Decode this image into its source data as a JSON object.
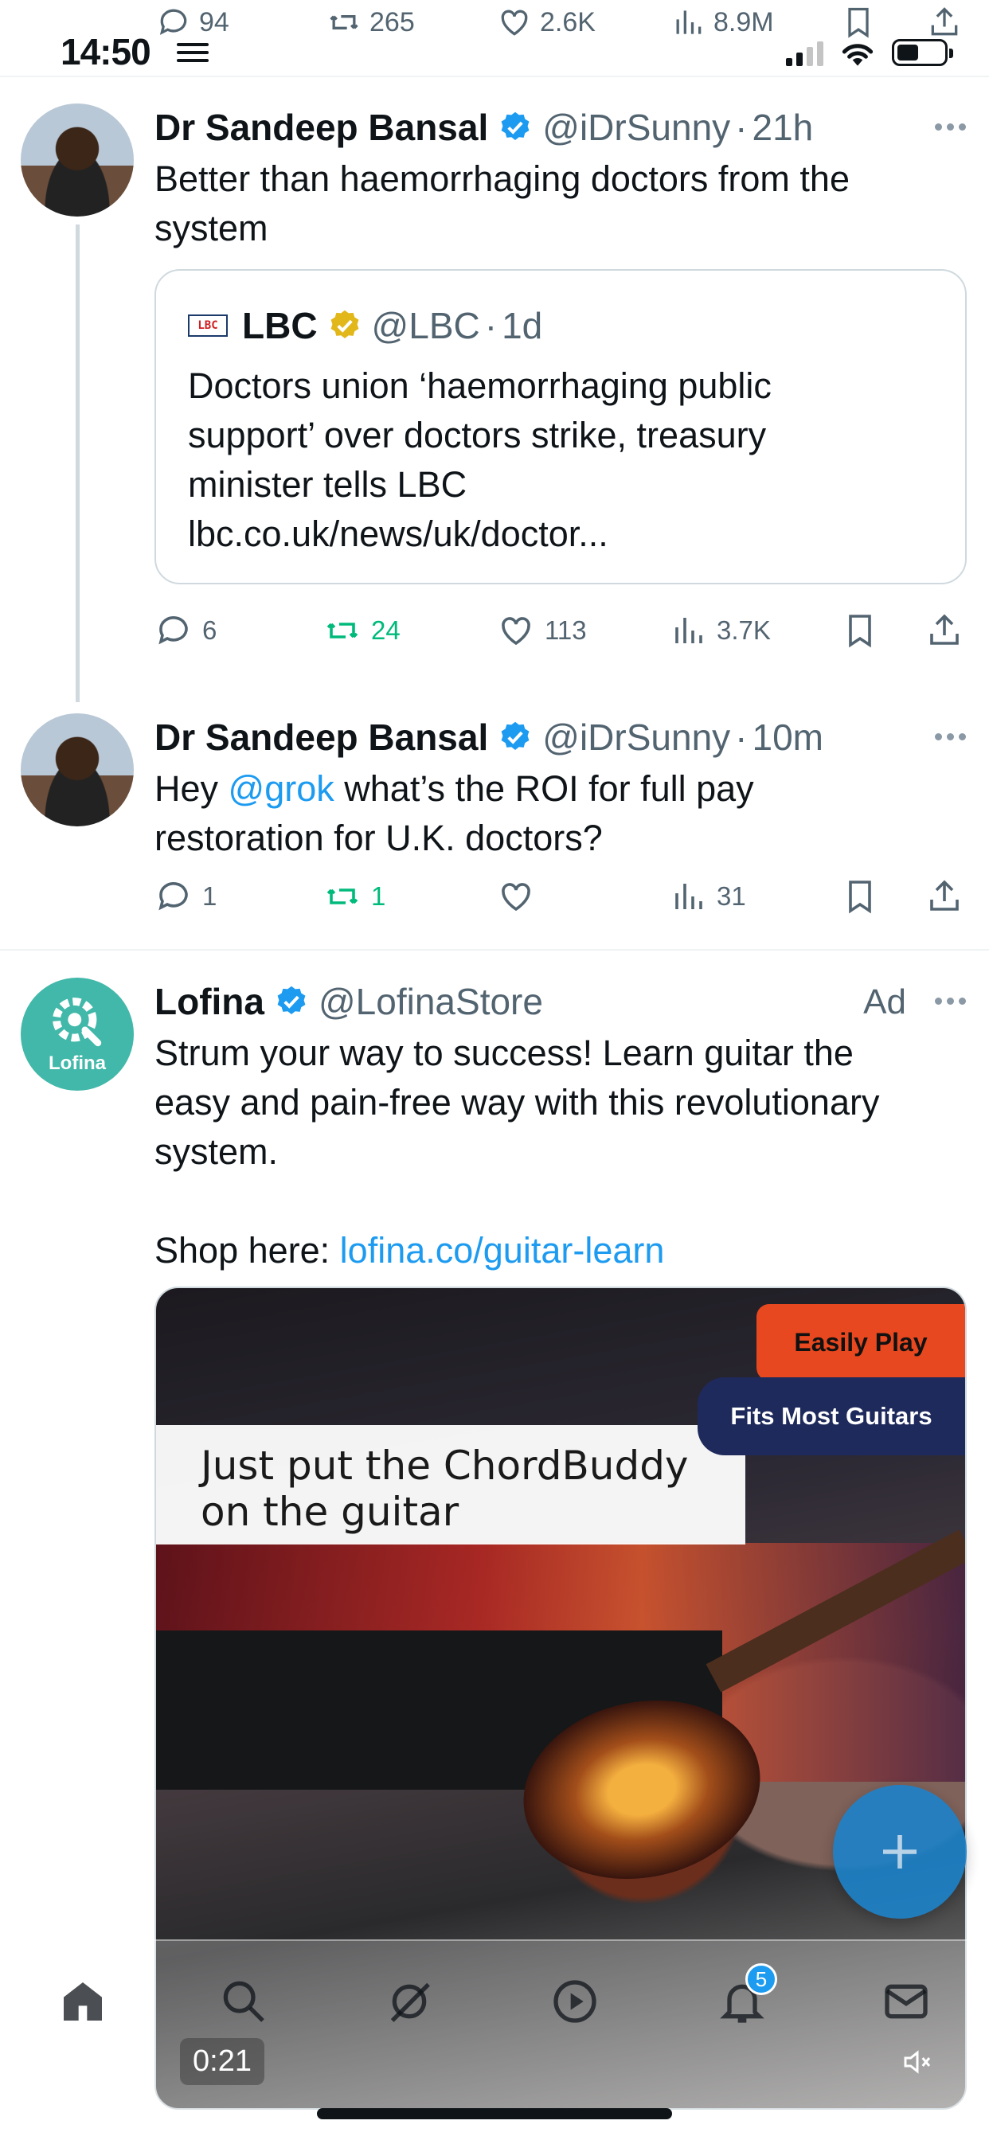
{
  "status_bar": {
    "time": "14:50"
  },
  "prev_actions": {
    "replies": "94",
    "reposts": "265",
    "likes": "2.6K",
    "views": "8.9M"
  },
  "tweets": [
    {
      "name": "Dr Sandeep Bansal",
      "handle": "@iDrSunny",
      "time": "21h",
      "text": "Better than haemorrhaging doctors from the\nsystem",
      "quote": {
        "name": "LBC",
        "handle": "@LBC",
        "time": "1d",
        "text": "Doctors union ‘haemorrhaging public\nsupport’ over doctors strike, treasury\nminister tells LBC\nlbc.co.uk/news/uk/doctor..."
      },
      "actions": {
        "replies": "6",
        "reposts": "24",
        "likes": "113",
        "views": "3.7K"
      }
    },
    {
      "name": "Dr Sandeep Bansal",
      "handle": "@iDrSunny",
      "time": "10m",
      "text_before": "Hey ",
      "mention": "@grok",
      "text_after": " what’s the ROI for full pay\nrestoration for U.K. doctors?",
      "actions": {
        "replies": "1",
        "reposts": "1",
        "likes": "",
        "views": "31"
      }
    },
    {
      "name": "Lofina",
      "handle": "@LofinaStore",
      "ad_label": "Ad",
      "avatar_text": "Lofina",
      "text": "Strum your way to success! Learn guitar the\neasy and pain-free way with this revolutionary\nsystem.",
      "shop_prefix": "Shop here: ",
      "shop_link": "lofina.co/guitar-learn",
      "media": {
        "caption": "Just put the ChordBuddy\non the guitar",
        "badge_easy": "Easily Play",
        "badge_fits": "Fits Most Guitars",
        "timer": "0:21"
      }
    }
  ],
  "nav": {
    "notification_count": "5"
  },
  "colors": {
    "accent": "#1d9bf0",
    "repost": "#00ba7c",
    "text": "#0f1419",
    "muted": "#536471"
  }
}
